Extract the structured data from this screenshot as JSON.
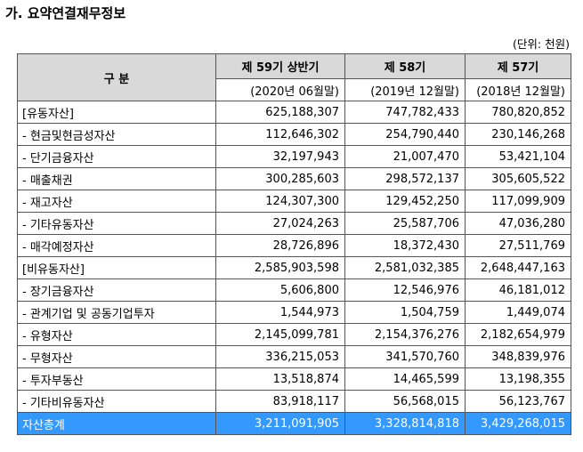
{
  "title": "가. 요약연결재무정보",
  "unit": "(단위: 천원)",
  "header": {
    "col0": "구      분",
    "periods": [
      "제 59기 상반기",
      "제 58기",
      "제 57기"
    ],
    "dates": [
      "(2020년 06월말)",
      "(2019년 12월말)",
      "(2018년 12월말)"
    ]
  },
  "rows": [
    {
      "label": "[유동자산]",
      "values": [
        "625,188,307",
        "747,782,433",
        "780,820,852"
      ]
    },
    {
      "label": " - 현금및현금성자산",
      "values": [
        "112,646,302",
        "254,790,440",
        "230,146,268"
      ]
    },
    {
      "label": " - 단기금융자산",
      "values": [
        "32,197,943",
        "21,007,470",
        "53,421,104"
      ]
    },
    {
      "label": " - 매출채권",
      "values": [
        "300,285,603",
        "298,572,137",
        "305,605,522"
      ]
    },
    {
      "label": " - 재고자산",
      "values": [
        "124,307,300",
        "129,452,250",
        "117,099,909"
      ]
    },
    {
      "label": " - 기타유동자산",
      "values": [
        "27,024,263",
        "25,587,706",
        "47,036,280"
      ]
    },
    {
      "label": " - 매각예정자산",
      "values": [
        "28,726,896",
        "18,372,430",
        "27,511,769"
      ]
    },
    {
      "label": "[비유동자산]",
      "values": [
        "2,585,903,598",
        "2,581,032,385",
        "2,648,447,163"
      ]
    },
    {
      "label": " - 장기금융자산",
      "values": [
        "5,606,800",
        "12,546,976",
        "46,181,012"
      ]
    },
    {
      "label": " - 관계기업 및 공동기업투자",
      "values": [
        "1,544,973",
        "1,504,759",
        "1,449,074"
      ]
    },
    {
      "label": " - 유형자산",
      "values": [
        "2,145,099,781",
        "2,154,376,276",
        "2,182,654,979"
      ]
    },
    {
      "label": " - 무형자산",
      "values": [
        "336,215,053",
        "341,570,760",
        "348,839,976"
      ]
    },
    {
      "label": " - 투자부동산",
      "values": [
        "13,518,874",
        "14,465,599",
        "13,198,355"
      ]
    },
    {
      "label": " - 기타비유동자산",
      "values": [
        "83,918,117",
        "56,568,015",
        "56,123,767"
      ]
    },
    {
      "label": "자산총계",
      "values": [
        "3,211,091,905",
        "3,328,814,818",
        "3,429,268,015"
      ],
      "highlight": true
    }
  ]
}
